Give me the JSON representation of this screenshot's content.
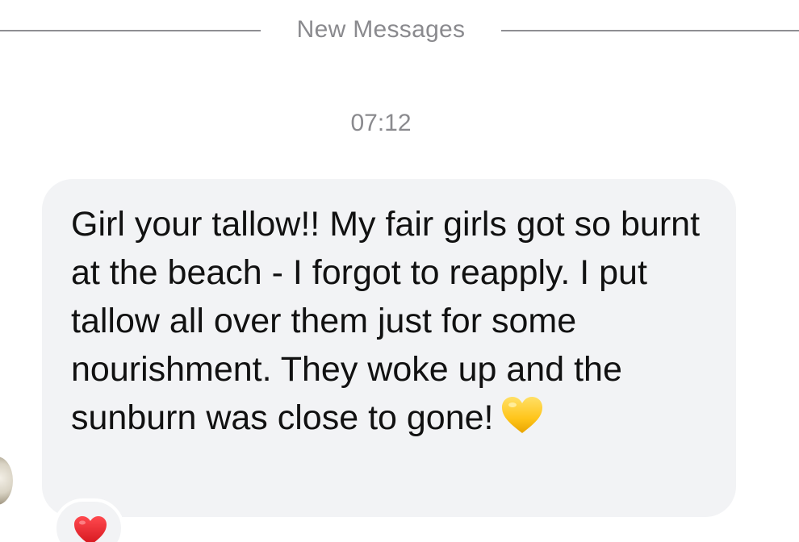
{
  "divider": {
    "label": "New Messages"
  },
  "timestamp": "07:12",
  "message": {
    "text": "Girl your tallow!! My fair girls got so burnt at the beach - I forgot to reapply. I put tallow all over them just for some nourishment. They woke up and the sunburn was close to gone!",
    "emoji": "yellow-heart",
    "emoji_color": "#FFCC22",
    "bubble_color": "#F2F3F5"
  },
  "reaction": {
    "emoji": "red-heart",
    "color": "#E0242B"
  },
  "avatar": {
    "icon": "sender-avatar"
  }
}
